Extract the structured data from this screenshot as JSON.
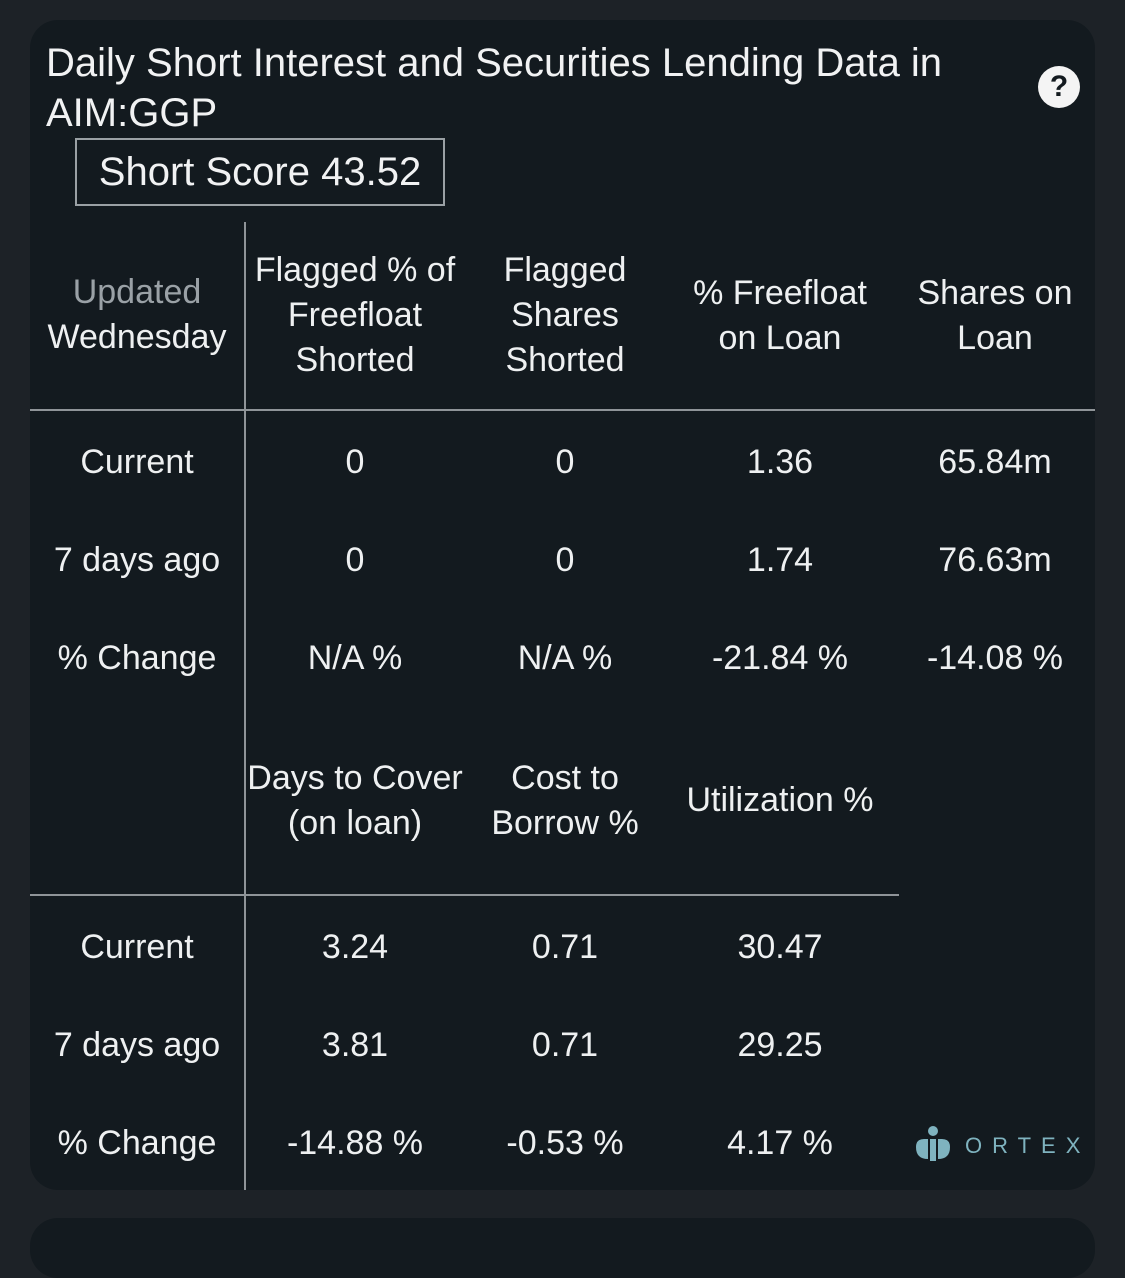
{
  "title": "Daily Short Interest and Securities Lending Data in AIM:GGP",
  "help_label": "?",
  "short_score": "Short Score 43.52",
  "table1": {
    "corner_top": "Updated",
    "corner_bottom": "Wednesday",
    "headers": [
      "Flagged % of Freefloat Shorted",
      "Flagged Shares Shorted",
      "% Freefloat on Loan",
      "Shares on Loan"
    ],
    "rows": [
      {
        "label": "Current",
        "values": [
          "0",
          "0",
          "1.36",
          "65.84m"
        ]
      },
      {
        "label": "7 days ago",
        "values": [
          "0",
          "0",
          "1.74",
          "76.63m"
        ]
      },
      {
        "label": "% Change",
        "values": [
          "N/A %",
          "N/A %",
          "-21.84 %",
          "-14.08 %"
        ]
      }
    ]
  },
  "table2": {
    "headers": [
      "Days to Cover (on loan)",
      "Cost to Borrow %",
      "Utilization %"
    ],
    "rows": [
      {
        "label": "Current",
        "values": [
          "3.24",
          "0.71",
          "30.47"
        ]
      },
      {
        "label": "7 days ago",
        "values": [
          "3.81",
          "0.71",
          "29.25"
        ]
      },
      {
        "label": "% Change",
        "values": [
          "-14.88 %",
          "-0.53 %",
          "4.17 %"
        ]
      }
    ]
  },
  "logo": {
    "text": "ORTEX",
    "color": "#7fb3bf"
  }
}
